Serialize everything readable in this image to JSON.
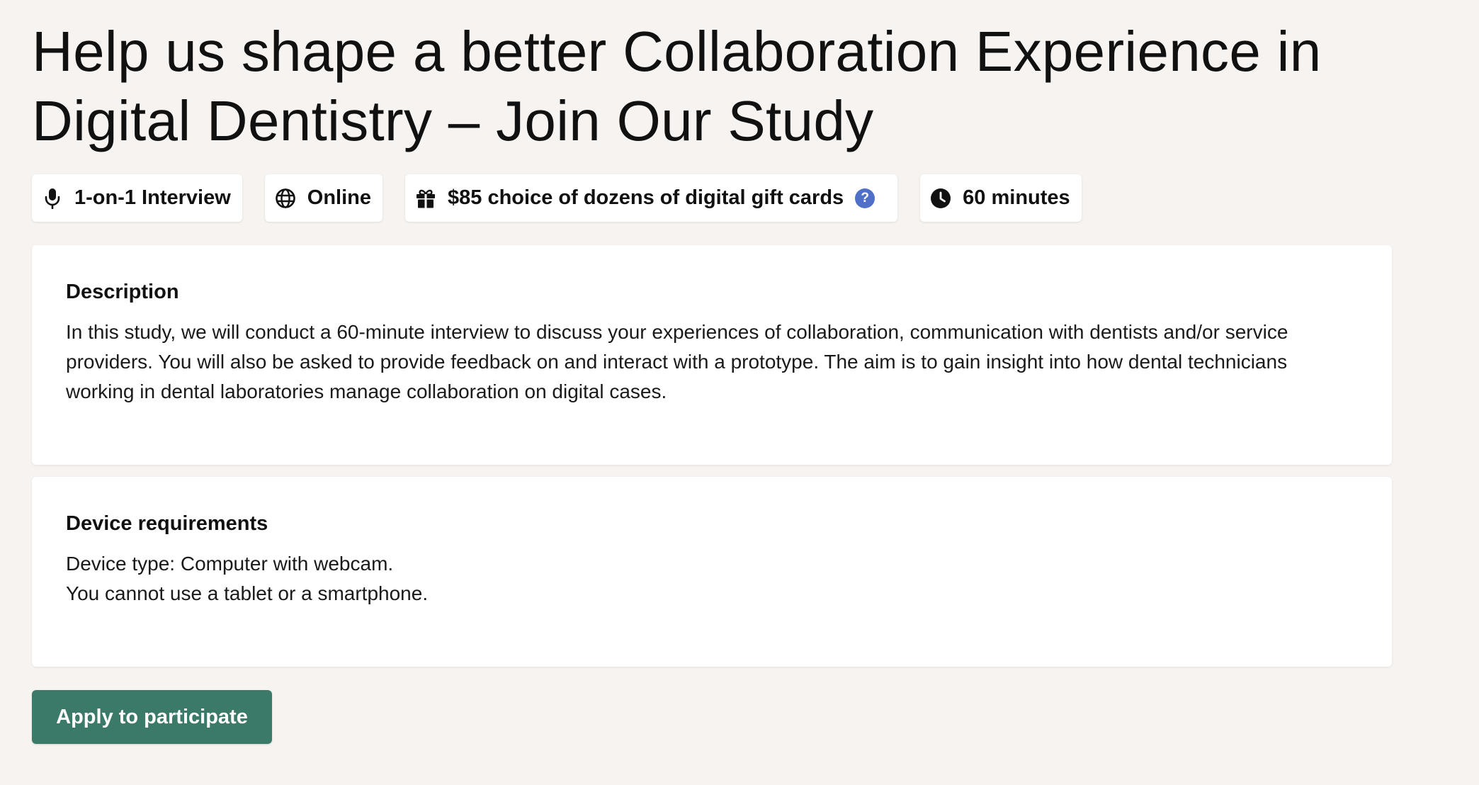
{
  "title_line1": "Help us shape a better Collaboration Experience in",
  "title_line2": "Digital Dentistry – Join Our Study",
  "chips": [
    {
      "icon": "microphone-icon",
      "label": "1-on-1 Interview"
    },
    {
      "icon": "globe-icon",
      "label": "Online"
    },
    {
      "icon": "gift-icon",
      "label": "$85 choice of dozens of digital gift cards",
      "help": "?"
    },
    {
      "icon": "clock-icon",
      "label": "60 minutes"
    }
  ],
  "description": {
    "heading": "Description",
    "text": "In this study, we will conduct a 60-minute interview to discuss your experiences of collaboration, communication with dentists and/or service providers. You will also be asked to provide feedback on and interact with a prototype. The aim is to gain insight into how dental technicians working in dental laboratories manage collaboration on digital cases."
  },
  "device": {
    "heading": "Device requirements",
    "line1": "Device type: Computer with webcam.",
    "line2": "You cannot use a tablet or a smartphone."
  },
  "apply_label": "Apply to participate",
  "colors": {
    "background": "#f7f3f0",
    "card": "#ffffff",
    "primary_button": "#3b7a68",
    "help_badge": "#4f6fc9"
  }
}
